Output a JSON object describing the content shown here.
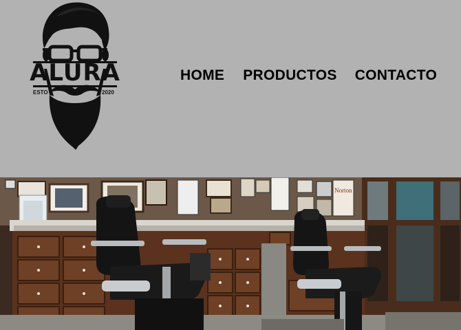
{
  "brand": {
    "name": "ALURA",
    "esto": "ESTO",
    "year": "2020"
  },
  "nav": {
    "home": "HOME",
    "productos": "PRODUCTOS",
    "contacto": "CONTACTO"
  },
  "hero": {
    "sign": "Norton"
  },
  "colors": {
    "header_bg": "#b2b2b2",
    "text": "#000000"
  }
}
